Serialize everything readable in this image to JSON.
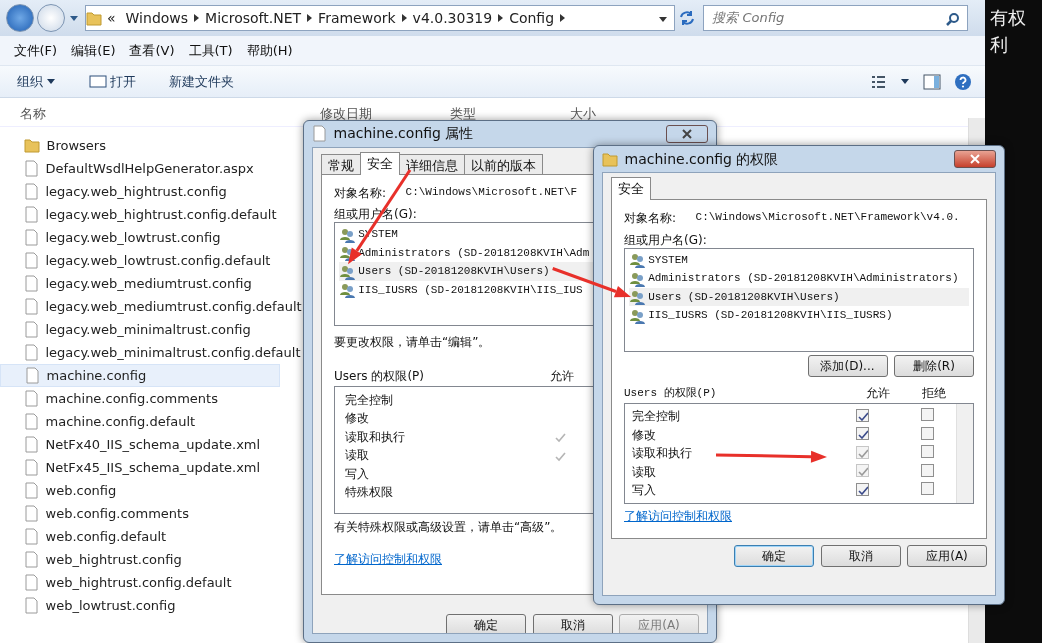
{
  "explorer": {
    "address": {
      "overflow": "«",
      "path": [
        "Windows",
        "Microsoft.NET",
        "Framework",
        "v4.0.30319",
        "Config"
      ]
    },
    "search": {
      "placeholder": "搜索 Config"
    },
    "menu": [
      "文件(F)",
      "编辑(E)",
      "查看(V)",
      "工具(T)",
      "帮助(H)"
    ],
    "toolbar": [
      {
        "label": "组织",
        "kind": "dropdown"
      },
      {
        "label": "打开",
        "kind": "open"
      },
      {
        "label": "新建文件夹",
        "kind": "plain"
      }
    ],
    "columns": [
      "名称",
      "修改日期",
      "类型",
      "大小"
    ],
    "files": [
      {
        "name": "Browsers",
        "kind": "folder",
        "selected": false
      },
      {
        "name": "DefaultWsdlHelpGenerator.aspx",
        "kind": "file",
        "selected": false
      },
      {
        "name": "legacy.web_hightrust.config",
        "kind": "file",
        "selected": false
      },
      {
        "name": "legacy.web_hightrust.config.default",
        "kind": "file",
        "selected": false
      },
      {
        "name": "legacy.web_lowtrust.config",
        "kind": "file",
        "selected": false
      },
      {
        "name": "legacy.web_lowtrust.config.default",
        "kind": "file",
        "selected": false
      },
      {
        "name": "legacy.web_mediumtrust.config",
        "kind": "file",
        "selected": false
      },
      {
        "name": "legacy.web_mediumtrust.config.default",
        "kind": "file",
        "selected": false
      },
      {
        "name": "legacy.web_minimaltrust.config",
        "kind": "file",
        "selected": false
      },
      {
        "name": "legacy.web_minimaltrust.config.default",
        "kind": "file",
        "selected": false
      },
      {
        "name": "machine.config",
        "kind": "file",
        "selected": true
      },
      {
        "name": "machine.config.comments",
        "kind": "file",
        "selected": false
      },
      {
        "name": "machine.config.default",
        "kind": "file",
        "selected": false
      },
      {
        "name": "NetFx40_IIS_schema_update.xml",
        "kind": "file",
        "selected": false
      },
      {
        "name": "NetFx45_IIS_schema_update.xml",
        "kind": "file",
        "selected": false
      },
      {
        "name": "web.config",
        "kind": "file",
        "selected": false
      },
      {
        "name": "web.config.comments",
        "kind": "file",
        "selected": false
      },
      {
        "name": "web.config.default",
        "kind": "file",
        "selected": false
      },
      {
        "name": "web_hightrust.config",
        "kind": "file",
        "selected": false
      },
      {
        "name": "web_hightrust.config.default",
        "kind": "file",
        "selected": false
      },
      {
        "name": "web_lowtrust.config",
        "kind": "file",
        "selected": false
      }
    ]
  },
  "side_text": "有权利",
  "properties_dialog": {
    "title": "machine.config 属性",
    "tabs": [
      {
        "label": "常规",
        "selected": false
      },
      {
        "label": "安全",
        "selected": true
      },
      {
        "label": "详细信息",
        "selected": false
      },
      {
        "label": "以前的版本",
        "selected": false
      }
    ],
    "object_label": "对象名称:",
    "object_value": "C:\\Windows\\Microsoft.NET\\F",
    "group_label": "组或用户名(G):",
    "users": [
      {
        "name": "SYSTEM",
        "selected": false
      },
      {
        "name": "Administrators (SD-20181208KVIH\\Adm",
        "selected": false
      },
      {
        "name": "Users (SD-20181208KVIH\\Users)",
        "selected": true
      },
      {
        "name": "IIS_IUSRS (SD-20181208KVIH\\IIS_IUS",
        "selected": false
      }
    ],
    "edit_hint": "要更改权限，请单击“编辑”。",
    "perm_label": "Users 的权限(P)",
    "allow_header": "允许",
    "permissions": [
      {
        "name": "完全控制",
        "allowed": false
      },
      {
        "name": "修改",
        "allowed": false
      },
      {
        "name": "读取和执行",
        "allowed": true
      },
      {
        "name": "读取",
        "allowed": true
      },
      {
        "name": "写入",
        "allowed": false
      },
      {
        "name": "特殊权限",
        "allowed": false
      }
    ],
    "advanced_hint": "有关特殊权限或高级设置，请单击“高级”。",
    "link": "了解访问控制和权限",
    "buttons": [
      {
        "label": "确定",
        "disabled": false
      },
      {
        "label": "取消",
        "disabled": false
      },
      {
        "label": "应用(A)",
        "disabled": true
      }
    ]
  },
  "permissions_dialog": {
    "title": "machine.config 的权限",
    "tabs": [
      {
        "label": "安全",
        "selected": true
      }
    ],
    "object_label": "对象名称:",
    "object_value": "C:\\Windows\\Microsoft.NET\\Framework\\v4.0.",
    "group_label": "组或用户名(G):",
    "users": [
      {
        "name": "SYSTEM",
        "selected": false
      },
      {
        "name": "Administrators (SD-20181208KVIH\\Administrators)",
        "selected": false
      },
      {
        "name": "Users (SD-20181208KVIH\\Users)",
        "selected": true
      },
      {
        "name": "IIS_IUSRS (SD-20181208KVIH\\IIS_IUSRS)",
        "selected": false
      }
    ],
    "user_buttons": [
      "添加(D)...",
      "删除(R)"
    ],
    "perm_label": "Users 的权限(P)",
    "allow_header": "允许",
    "deny_header": "拒绝",
    "permissions": [
      {
        "name": "完全控制",
        "allow": true,
        "allow_disabled": false,
        "deny": false
      },
      {
        "name": "修改",
        "allow": true,
        "allow_disabled": false,
        "deny": false
      },
      {
        "name": "读取和执行",
        "allow": true,
        "allow_disabled": true,
        "deny": false
      },
      {
        "name": "读取",
        "allow": true,
        "allow_disabled": true,
        "deny": false
      },
      {
        "name": "写入",
        "allow": true,
        "allow_disabled": false,
        "deny": false
      }
    ],
    "link": "了解访问控制和权限",
    "buttons": [
      {
        "label": "确定",
        "disabled": false
      },
      {
        "label": "取消",
        "disabled": false
      },
      {
        "label": "应用(A)",
        "disabled": false
      }
    ]
  }
}
